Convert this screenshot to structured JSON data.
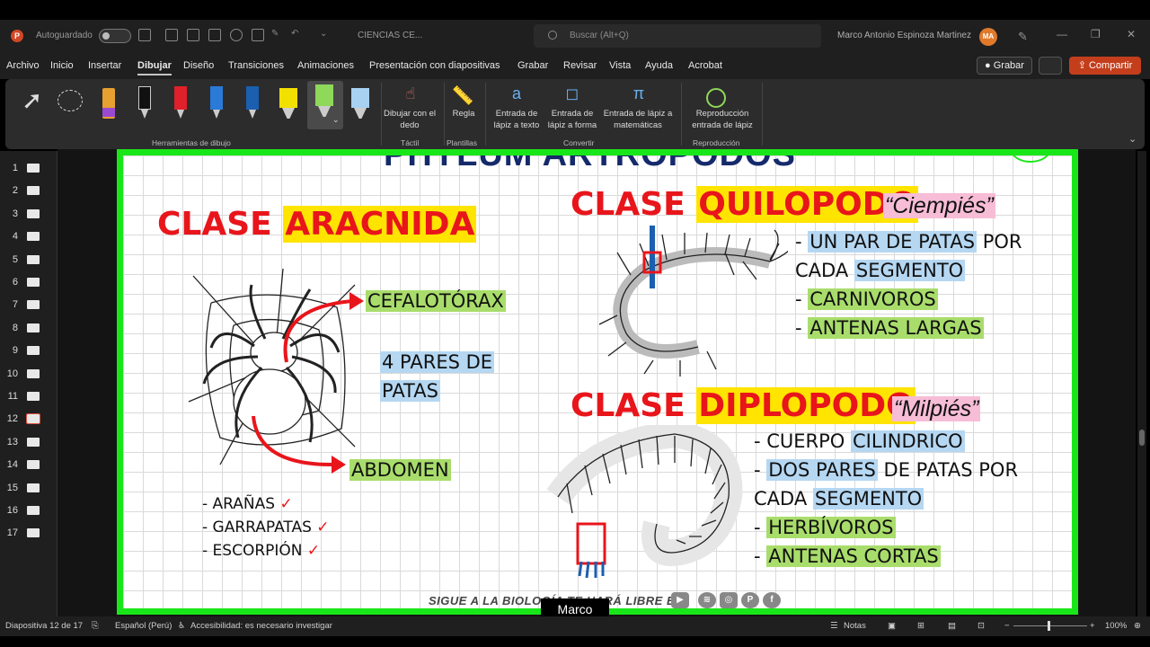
{
  "titlebar": {
    "autosave": "Autoguardado",
    "doc_name": "CIENCIAS CE...",
    "search_placeholder": "Buscar (Alt+Q)",
    "user": "Marco Antonio Espinoza Martinez",
    "initials": "MA"
  },
  "menu": {
    "items": [
      "Archivo",
      "Inicio",
      "Insertar",
      "Dibujar",
      "Diseño",
      "Transiciones",
      "Animaciones",
      "Presentación con diapositivas",
      "Grabar",
      "Revisar",
      "Vista",
      "Ayuda",
      "Acrobat"
    ],
    "active": "Dibujar",
    "grabar": "Grabar",
    "compartir": "Compartir"
  },
  "ribbon": {
    "group_drawing_tools": "Herramientas de dibujo",
    "dibujar_dedo": "Dibujar con el dedo",
    "group_tactil": "Táctil",
    "regla": "Regla",
    "group_plantillas": "Plantillas",
    "entrada_texto": "Entrada de lápiz a texto",
    "entrada_forma": "Entrada de lápiz a forma",
    "entrada_mate": "Entrada de lápiz a matemáticas",
    "group_convertir": "Convertir",
    "reproduccion": "Reproducción entrada de lápiz",
    "group_reproduccion": "Reproducción",
    "pen_colors": [
      "#e8a030",
      "#111111",
      "#e0202a",
      "#2a7ad8",
      "#1a5fb0",
      "#f2e000",
      "#8ed85a",
      "#a8d0f0"
    ]
  },
  "thumbnails": [
    "1",
    "2",
    "3",
    "4",
    "5",
    "6",
    "7",
    "8",
    "9",
    "10",
    "11",
    "12",
    "13",
    "14",
    "15",
    "16",
    "17"
  ],
  "active_slide": "12",
  "slide": {
    "title": "PHYLUM ARTRÓPODOS",
    "aracnida": {
      "clase": "CLASE",
      "name": "ARACNIDA",
      "cefalotorax": "CEFALOTÓRAX",
      "pares": "4 PARES DE",
      "patas": "PATAS",
      "abdomen": "ABDOMEN",
      "ejemplos": [
        "- ARAÑAS",
        "- GARRAPATAS",
        "- ESCORPIÓN"
      ]
    },
    "quilopodo": {
      "clase": "CLASE",
      "name": "QUILOPODO",
      "common": "“Ciempiés”",
      "l1a": "- ",
      "l1b": "UN PAR DE PATAS",
      "l1c": " POR",
      "l2a": "CADA ",
      "l2b": "SEGMENTO",
      "l3a": "- ",
      "l3b": "CARNIVOROS",
      "l4a": "- ",
      "l4b": "ANTENAS LARGAS"
    },
    "diplopodo": {
      "clase": "CLASE",
      "name": "DIPLOPODO",
      "common": "“Milpiés”",
      "l1a": "- CUERPO ",
      "l1b": "CILINDRICO",
      "l2a": "- ",
      "l2b": "DOS PARES",
      "l2c": " DE PATAS POR",
      "l3a": "CADA ",
      "l3b": "SEGMENTO",
      "l4a": "- ",
      "l4b": "HERBÍVOROS",
      "l5a": "- ",
      "l5b": "ANTENAS CORTAS"
    },
    "footer": "SIGUE A LA BIOLOGÍA TE HARÁ LIBRE EN"
  },
  "caption": "Marco",
  "status": {
    "slide_info": "Diapositiva 12 de 17",
    "lang": "Español (Perú)",
    "accessibility": "Accesibilidad: es necesario investigar",
    "notes": "Notas",
    "zoom": "100%"
  }
}
